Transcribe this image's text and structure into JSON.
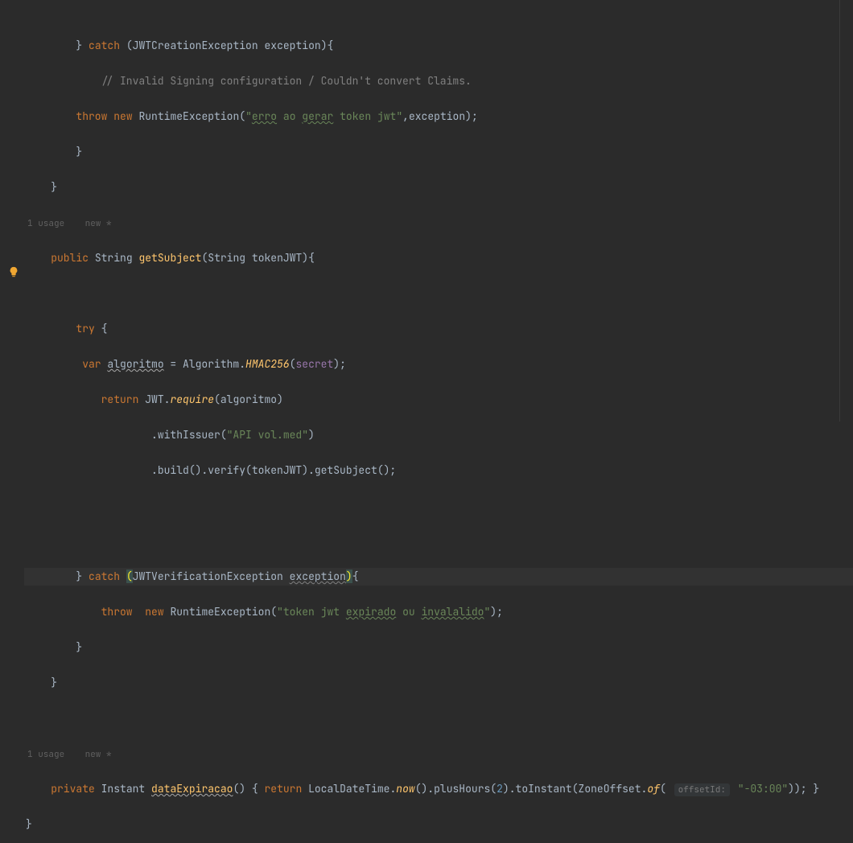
{
  "code": {
    "l1": {
      "catch": "catch",
      "brace": "} ",
      "paren": "(",
      "ex_type": "JWTCreationException",
      "ex_name": " exception",
      "close": "){"
    },
    "l2": {
      "comment": "// Invalid Signing configuration / Couldn't convert Claims."
    },
    "l3": {
      "throw": "throw",
      "new": "new",
      "rtex": "RuntimeException",
      "open": "(",
      "q1": "\"",
      "erro": "erro",
      "sp1": " ao ",
      "gerar": "gerar",
      "sp2": " token jwt\"",
      "comma": ",",
      "exc": "exception",
      "close": ");"
    },
    "l4": {
      "brace": "}"
    },
    "l5": {
      "brace": "}"
    },
    "meta1": {
      "usage": "1 usage",
      "new": "new *"
    },
    "l6": {
      "pub": "public",
      "ret": "String",
      "fn": "getSubject",
      "open": "(",
      "ptype": "String",
      "pname": " tokenJWT",
      "close": "){"
    },
    "l7": {
      "try": "try",
      "brace": " {"
    },
    "l8": {
      "var": "var",
      "name": "algoritmo",
      "eq": " = ",
      "cls": "Algorithm",
      "dot": ".",
      "hmac": "HMAC256",
      "open": "(",
      "secret": "secret",
      "close": ");"
    },
    "l9": {
      "return": "return",
      "jwt": " JWT.",
      "require": "require",
      "open": "(",
      "arg": "algoritmo",
      "close": ")"
    },
    "l10": {
      "dot": ".withIssuer(",
      "str": "\"API vol.med\"",
      "close": ")"
    },
    "l11": {
      "text": ".build().verify(tokenJWT).getSubject();"
    },
    "l12": {
      "brace": "} ",
      "catch": "catch",
      "open": "(",
      "ex_type": "JWTVerificationException ",
      "ex_name": "exception",
      "close": ")",
      "brace2": "{"
    },
    "l13": {
      "throw": "throw",
      "new": "new",
      "rtex": " RuntimeException(",
      "q": "\"token jwt ",
      "exp": "expirado",
      "ou": " ou ",
      "inv": "invalalido",
      "qc": "\"",
      "close": ");"
    },
    "l14": {
      "brace": "}"
    },
    "l15": {
      "brace": "}"
    },
    "meta2": {
      "usage": "1 usage",
      "new": "new *"
    },
    "l16": {
      "priv": "private",
      "ret": "Instant",
      "fn": "dataExpiracao",
      "parens": "() { ",
      "return": "return",
      "ldt": " LocalDateTime.",
      "now": "now",
      "np": "().plusHours(",
      "two": "2",
      "ti": ").toInstant(ZoneOffset.",
      "of": "of",
      "op": "(",
      "hint": "offsetId:",
      "offset": "\"-03:00\"",
      "close": ")); }"
    },
    "l17": {
      "brace": "}"
    }
  }
}
